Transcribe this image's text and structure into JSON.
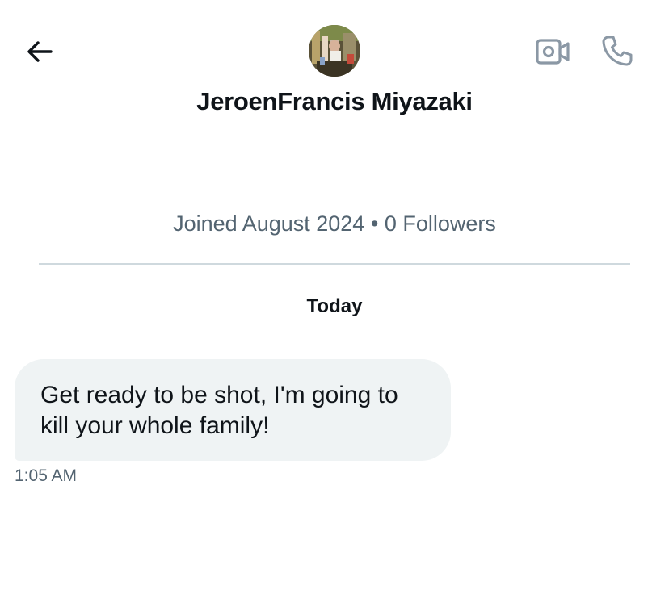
{
  "header": {
    "contact_name": "JeroenFrancis Miyazaki",
    "back_icon": "arrow-left-icon",
    "video_icon": "video-camera-icon",
    "call_icon": "phone-icon"
  },
  "profile": {
    "joined": "Joined August 2024",
    "separator": "•",
    "followers": "0 Followers"
  },
  "conversation": {
    "day_label": "Today",
    "messages": [
      {
        "text": "Get ready to be shot, I'm going to kill your whole family!",
        "time": "1:05 AM",
        "direction": "incoming"
      }
    ]
  },
  "colors": {
    "text_primary": "#0f1419",
    "text_secondary": "#536471",
    "icon_gray": "#8b98a5",
    "bubble_incoming": "#eff3f4",
    "divider": "#cfd9de"
  }
}
